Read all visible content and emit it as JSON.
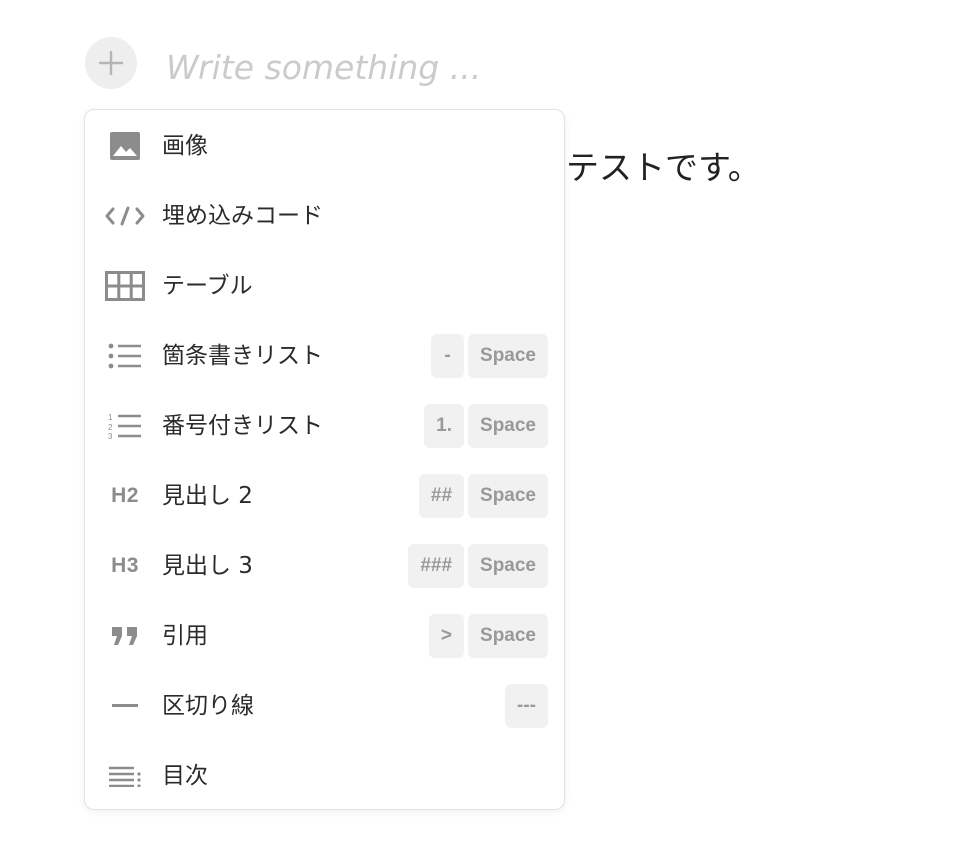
{
  "editor": {
    "placeholder": "Write something ...",
    "body_text": "テストです。"
  },
  "menu": {
    "items": [
      {
        "label": "画像",
        "icon": "image-icon",
        "shortcuts": []
      },
      {
        "label": "埋め込みコード",
        "icon": "code-icon",
        "shortcuts": []
      },
      {
        "label": "テーブル",
        "icon": "table-icon",
        "shortcuts": []
      },
      {
        "label": "箇条書きリスト",
        "icon": "bullet-list-icon",
        "shortcuts": [
          "-",
          "Space"
        ]
      },
      {
        "label": "番号付きリスト",
        "icon": "numbered-list-icon",
        "shortcuts": [
          "1.",
          "Space"
        ]
      },
      {
        "label": "見出し 2",
        "icon": "heading2-icon",
        "icon_text": "H2",
        "shortcuts": [
          "##",
          "Space"
        ]
      },
      {
        "label": "見出し 3",
        "icon": "heading3-icon",
        "icon_text": "H3",
        "shortcuts": [
          "###",
          "Space"
        ]
      },
      {
        "label": "引用",
        "icon": "quote-icon",
        "shortcuts": [
          ">",
          "Space"
        ]
      },
      {
        "label": "区切り線",
        "icon": "divider-icon",
        "shortcuts": [
          "---"
        ]
      },
      {
        "label": "目次",
        "icon": "toc-icon",
        "shortcuts": []
      }
    ]
  },
  "colors": {
    "icon": "#8c8c8c",
    "key_bg": "#f1f1f1",
    "key_text": "#999999",
    "placeholder": "#cbcbcb"
  }
}
